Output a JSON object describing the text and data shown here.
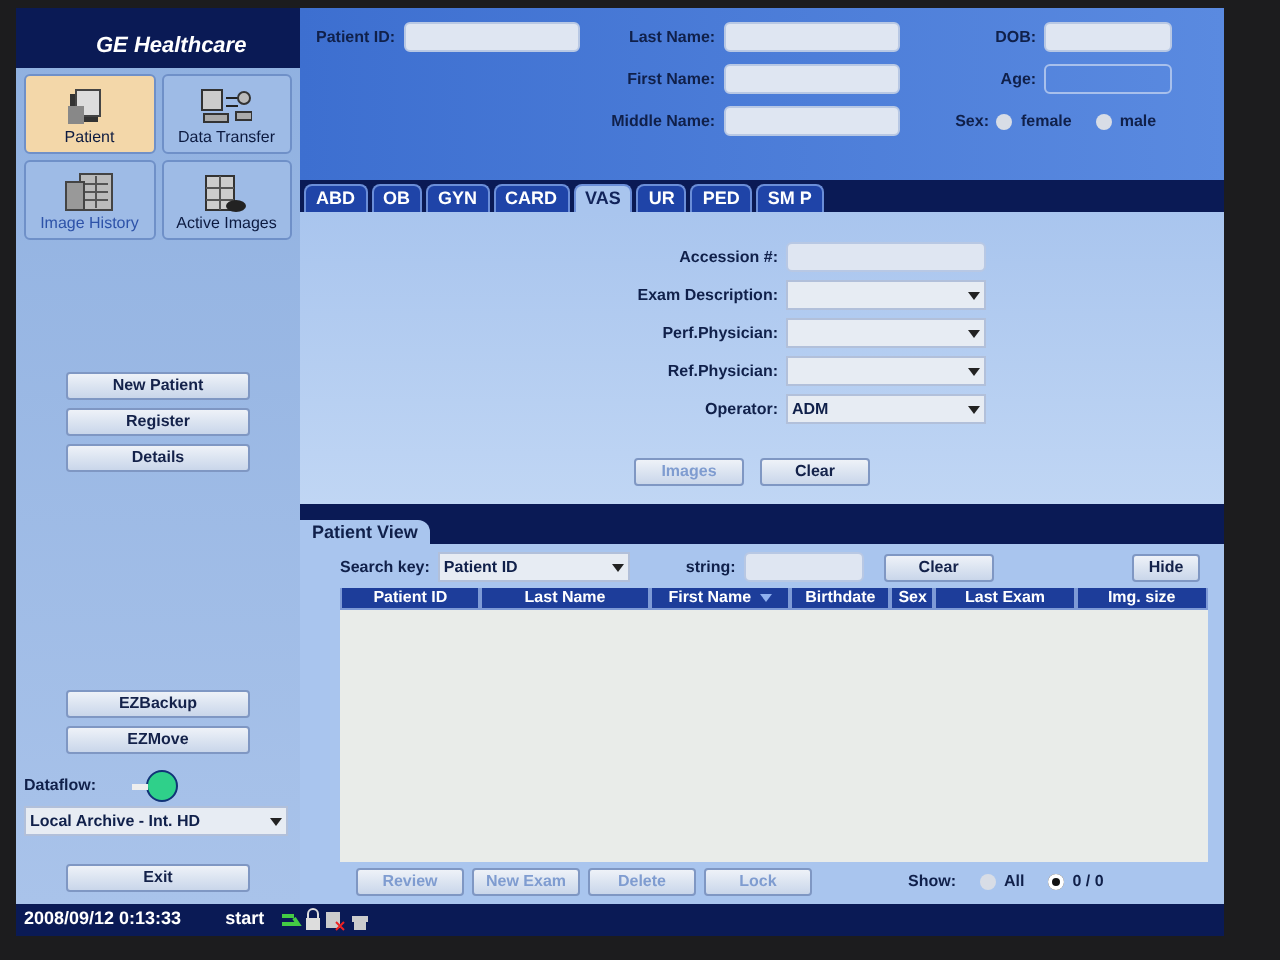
{
  "brand": "GE Healthcare",
  "nav": [
    {
      "label": "Patient",
      "kind": "folder",
      "selected": true,
      "dimmed": false
    },
    {
      "label": "Data Transfer",
      "kind": "transfer",
      "selected": false,
      "dimmed": false
    },
    {
      "label": "Image History",
      "kind": "history",
      "selected": false,
      "dimmed": true
    },
    {
      "label": "Active Images",
      "kind": "active",
      "selected": false,
      "dimmed": false
    }
  ],
  "side_buttons": [
    "New Patient",
    "Register",
    "Details"
  ],
  "tool_buttons": [
    "EZBackup",
    "EZMove"
  ],
  "dataflow": {
    "label": "Dataflow:",
    "value": "Local Archive - Int. HD"
  },
  "exit": "Exit",
  "patient_columns": [
    [
      {
        "label": "Patient ID:",
        "kind": "text"
      }
    ],
    [
      {
        "label": "Last Name:",
        "kind": "text"
      },
      {
        "label": "First Name:",
        "kind": "text"
      },
      {
        "label": "Middle Name:",
        "kind": "text"
      }
    ],
    [
      {
        "label": "DOB:",
        "kind": "text"
      },
      {
        "label": "Age:",
        "kind": "readonly"
      },
      {
        "label": "Sex:",
        "kind": "radio",
        "options": [
          {
            "label": "female",
            "selected": false
          },
          {
            "label": "male",
            "selected": false
          }
        ]
      }
    ]
  ],
  "tabs": [
    {
      "label": "ABD",
      "selected": false
    },
    {
      "label": "OB",
      "selected": false
    },
    {
      "label": "GYN",
      "selected": false
    },
    {
      "label": "CARD",
      "selected": false
    },
    {
      "label": "VAS",
      "selected": true
    },
    {
      "label": "UR",
      "selected": false
    },
    {
      "label": "PED",
      "selected": false
    },
    {
      "label": "SM P",
      "selected": false
    }
  ],
  "exam_fields": [
    {
      "label": "Accession #:",
      "kind": "text"
    },
    {
      "label": "Exam Description:",
      "kind": "select"
    },
    {
      "label": "Perf.Physician:",
      "kind": "select"
    },
    {
      "label": "Ref.Physician:",
      "kind": "select"
    },
    {
      "label": "Operator:",
      "kind": "select",
      "value": "ADM"
    }
  ],
  "exam_buttons": [
    {
      "label": "Images",
      "disabled": true
    },
    {
      "label": "Clear",
      "disabled": false
    }
  ],
  "patient_view": {
    "title": "Patient View",
    "search_label": "Search key:",
    "search_value": "Patient ID",
    "string_label": "string:",
    "clear": "Clear",
    "hide": "Hide",
    "columns": [
      {
        "label": "Patient ID",
        "sorted": false
      },
      {
        "label": "Last Name",
        "sorted": false
      },
      {
        "label": "First Name",
        "sorted": true
      },
      {
        "label": "Birthdate",
        "sorted": false
      },
      {
        "label": "Sex",
        "sorted": false
      },
      {
        "label": "Last Exam",
        "sorted": false
      },
      {
        "label": "Img. size",
        "sorted": false
      }
    ],
    "actions": [
      {
        "label": "Review",
        "disabled": true
      },
      {
        "label": "New Exam",
        "disabled": true
      },
      {
        "label": "Delete",
        "disabled": true
      },
      {
        "label": "Lock",
        "disabled": true
      }
    ],
    "show_label": "Show:",
    "show_options": [
      {
        "label": "All",
        "selected": false
      },
      {
        "label": "0 / 0",
        "selected": true
      }
    ]
  },
  "status_bar": {
    "time": "2008/09/12 0:13:33",
    "start": "start"
  }
}
